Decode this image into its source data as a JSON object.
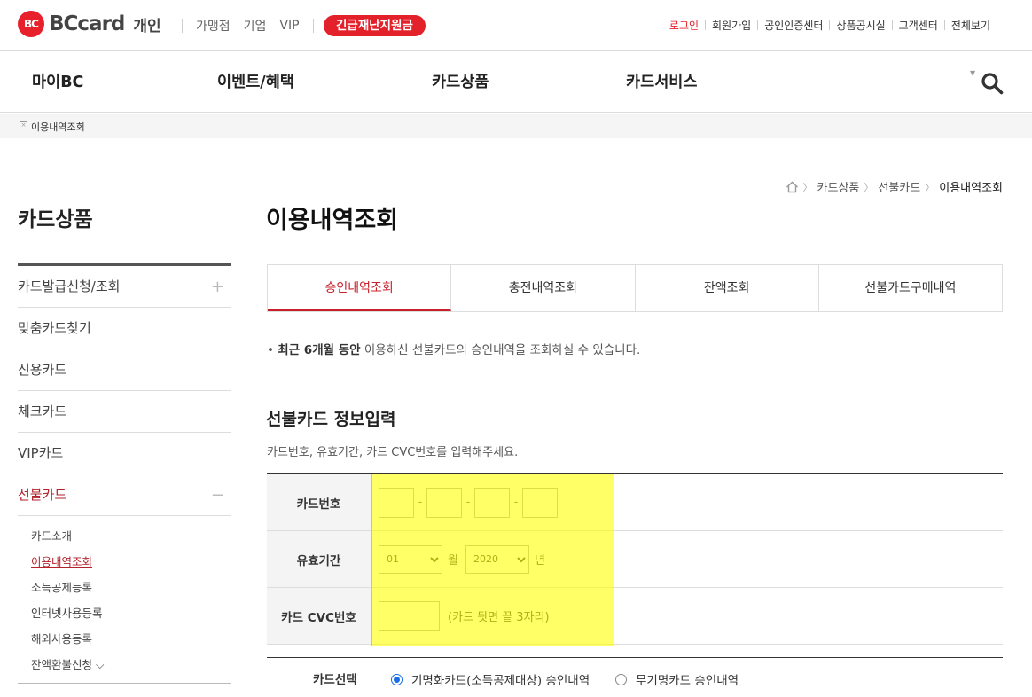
{
  "header": {
    "logo_mark": "BC",
    "logo_text": "BCcard",
    "logo_sub": "개인",
    "biz_links": [
      "가맹점",
      "기업",
      "VIP"
    ],
    "emergency_label": "긴급재난지원금",
    "util_links": [
      "로그인",
      "회원가입",
      "공인인증센터",
      "상품공시실",
      "고객센터",
      "전체보기"
    ]
  },
  "gnb": {
    "menus": [
      "마이BC",
      "이벤트/혜택",
      "카드상품",
      "카드서비스"
    ]
  },
  "location": {
    "text": "이용내역조회"
  },
  "breadcrumb": [
    "카드상품",
    "선불카드",
    "이용내역조회"
  ],
  "lnb": {
    "title": "카드상품",
    "items": [
      {
        "label": "카드발급신청/조회",
        "toggle": "+"
      },
      {
        "label": "맞춤카드찾기"
      },
      {
        "label": "신용카드"
      },
      {
        "label": "체크카드"
      },
      {
        "label": "VIP카드"
      },
      {
        "label": "선불카드",
        "toggle": "−"
      }
    ],
    "sub_items": [
      "카드소개",
      "이용내역조회",
      "소득공제등록",
      "인터넷사용등록",
      "해외사용등록",
      "잔액환불신청 ⌵"
    ]
  },
  "main": {
    "title": "이용내역조회",
    "tabs": [
      "승인내역조회",
      "충전내역조회",
      "잔액조회",
      "선불카드구매내역"
    ],
    "notice_bold": "최근 6개월 동안",
    "notice_rest": " 이용하신 선불카드의 승인내역을 조회하실 수 있습니다.",
    "notice_bullet": "•",
    "section_title": "선불카드 정보입력",
    "section_desc": "카드번호, 유효기간, 카드 CVC번호를 입력해주세요.",
    "form": {
      "card_number_label": "카드번호",
      "card_dash": "-",
      "expiry_label": "유효기간",
      "month_value": "01",
      "month_unit": "월",
      "year_value": "2020",
      "year_unit": "년",
      "cvc_label": "카드 CVC번호",
      "cvc_hint": "(카드 뒷면 끝 3자리)"
    },
    "card_select": {
      "label": "카드선택",
      "options": [
        "기명화카드(소득공제대상) 승인내역",
        "무기명카드 승인내역"
      ],
      "selected_index": 0
    }
  },
  "colors": {
    "brand_red": "#e3212b",
    "active_red": "#b3222b",
    "highlight": "#ffff00",
    "radio_blue": "#1a6ee8"
  }
}
